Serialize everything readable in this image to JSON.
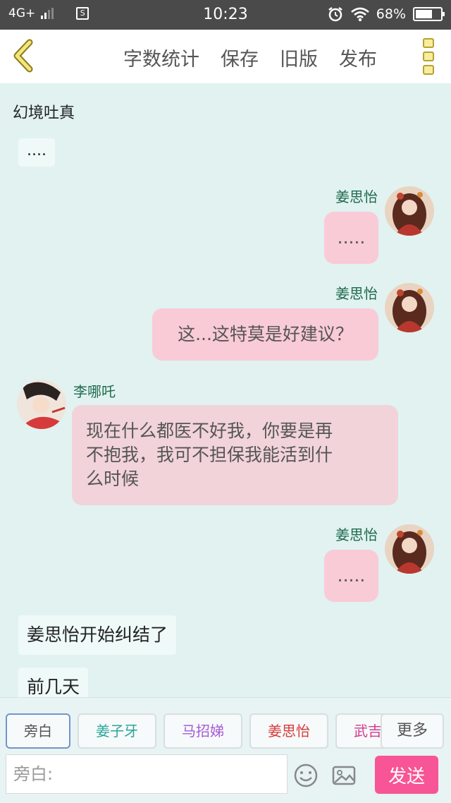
{
  "status_bar": {
    "network": "4G+",
    "time": "10:23",
    "battery_pct": "68%",
    "battery_level": 0.68,
    "sim_label": "S"
  },
  "nav": {
    "back_icon": "chevron-left-icon",
    "actions": [
      "字数统计",
      "保存",
      "旧版",
      "发布"
    ],
    "more_icon": "vertical-dots-icon"
  },
  "chat": {
    "title": "幻境吐真",
    "messages": [
      {
        "type": "narration",
        "text": "...."
      },
      {
        "type": "right",
        "name": "姜思怡",
        "text": "....."
      },
      {
        "type": "right",
        "name": "姜思怡",
        "text": "这...这特莫是好建议？"
      },
      {
        "type": "left",
        "name": "李哪吒",
        "lines": [
          "现在什么都医不好我，你要是再",
          "不抱我，我可不担保我能活到什",
          "么时候"
        ]
      },
      {
        "type": "right",
        "name": "姜思怡",
        "text": "....."
      },
      {
        "type": "narration",
        "text": "姜思怡开始纠结了"
      },
      {
        "type": "narration",
        "text": "前几天"
      }
    ]
  },
  "composer": {
    "roles": [
      {
        "label": "旁白",
        "color": "#555555"
      },
      {
        "label": "姜子牙",
        "color": "#2aa59a"
      },
      {
        "label": "马招娣",
        "color": "#a45bd6"
      },
      {
        "label": "姜思怡",
        "color": "#d53b3b"
      },
      {
        "label": "武吉",
        "color": "#d2398d"
      }
    ],
    "more_label": "更多",
    "input_placeholder": "旁白:",
    "send_label": "发送",
    "accent_color": "#f75595"
  }
}
